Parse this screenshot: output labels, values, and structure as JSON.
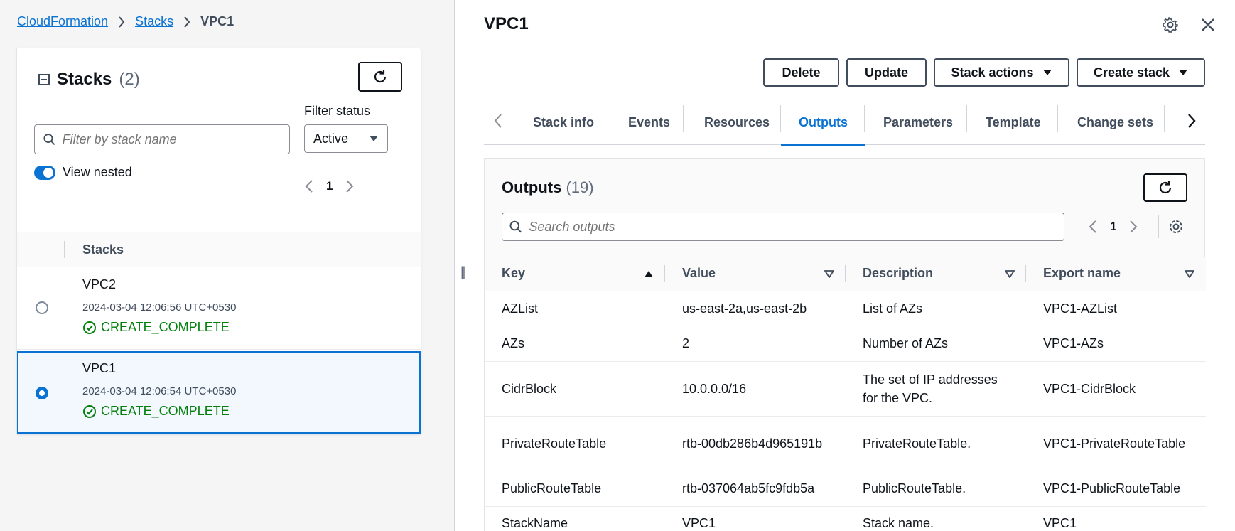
{
  "breadcrumb": {
    "root": "CloudFormation",
    "section": "Stacks",
    "current": "VPC1"
  },
  "stacks_panel": {
    "title": "Stacks",
    "count": "(2)",
    "filter_placeholder": "Filter by stack name",
    "filter_status_label": "Filter status",
    "filter_status_value": "Active",
    "view_nested_label": "View nested",
    "view_nested_on": true,
    "page": "1",
    "column_header": "Stacks",
    "rows": [
      {
        "name": "VPC2",
        "date": "2024-03-04 12:06:56 UTC+0530",
        "status": "CREATE_COMPLETE",
        "selected": false
      },
      {
        "name": "VPC1",
        "date": "2024-03-04 12:06:54 UTC+0530",
        "status": "CREATE_COMPLETE",
        "selected": true
      }
    ]
  },
  "detail": {
    "title": "VPC1",
    "buttons": {
      "delete": "Delete",
      "update": "Update",
      "stack_actions": "Stack actions",
      "create_stack": "Create stack"
    },
    "tabs": [
      "Stack info",
      "Events",
      "Resources",
      "Outputs",
      "Parameters",
      "Template",
      "Change sets"
    ],
    "active_tab": "Outputs"
  },
  "outputs": {
    "title": "Outputs",
    "count": "(19)",
    "search_placeholder": "Search outputs",
    "page": "1",
    "columns": [
      "Key",
      "Value",
      "Description",
      "Export name"
    ],
    "rows": [
      {
        "key": "AZList",
        "value": "us-east-2a,us-east-2b",
        "description": "List of AZs",
        "export": "VPC1-AZList"
      },
      {
        "key": "AZs",
        "value": "2",
        "description": "Number of AZs",
        "export": "VPC1-AZs"
      },
      {
        "key": "CidrBlock",
        "value": "10.0.0.0/16",
        "description": "The set of IP addresses for the VPC.",
        "export": "VPC1-CidrBlock"
      },
      {
        "key": "PrivateRouteTable",
        "value": "rtb-00db286b4d965191b",
        "description": "PrivateRouteTable.",
        "export": "VPC1-PrivateRouteTable"
      },
      {
        "key": "PublicRouteTable",
        "value": "rtb-037064ab5fc9fdb5a",
        "description": "PublicRouteTable.",
        "export": "VPC1-PublicRouteTable"
      },
      {
        "key": "StackName",
        "value": "VPC1",
        "description": "Stack name.",
        "export": "VPC1"
      }
    ]
  },
  "colors": {
    "link": "#0972d3",
    "success": "#037f0c",
    "text": "#0f141a",
    "muted": "#5f6b7a"
  }
}
